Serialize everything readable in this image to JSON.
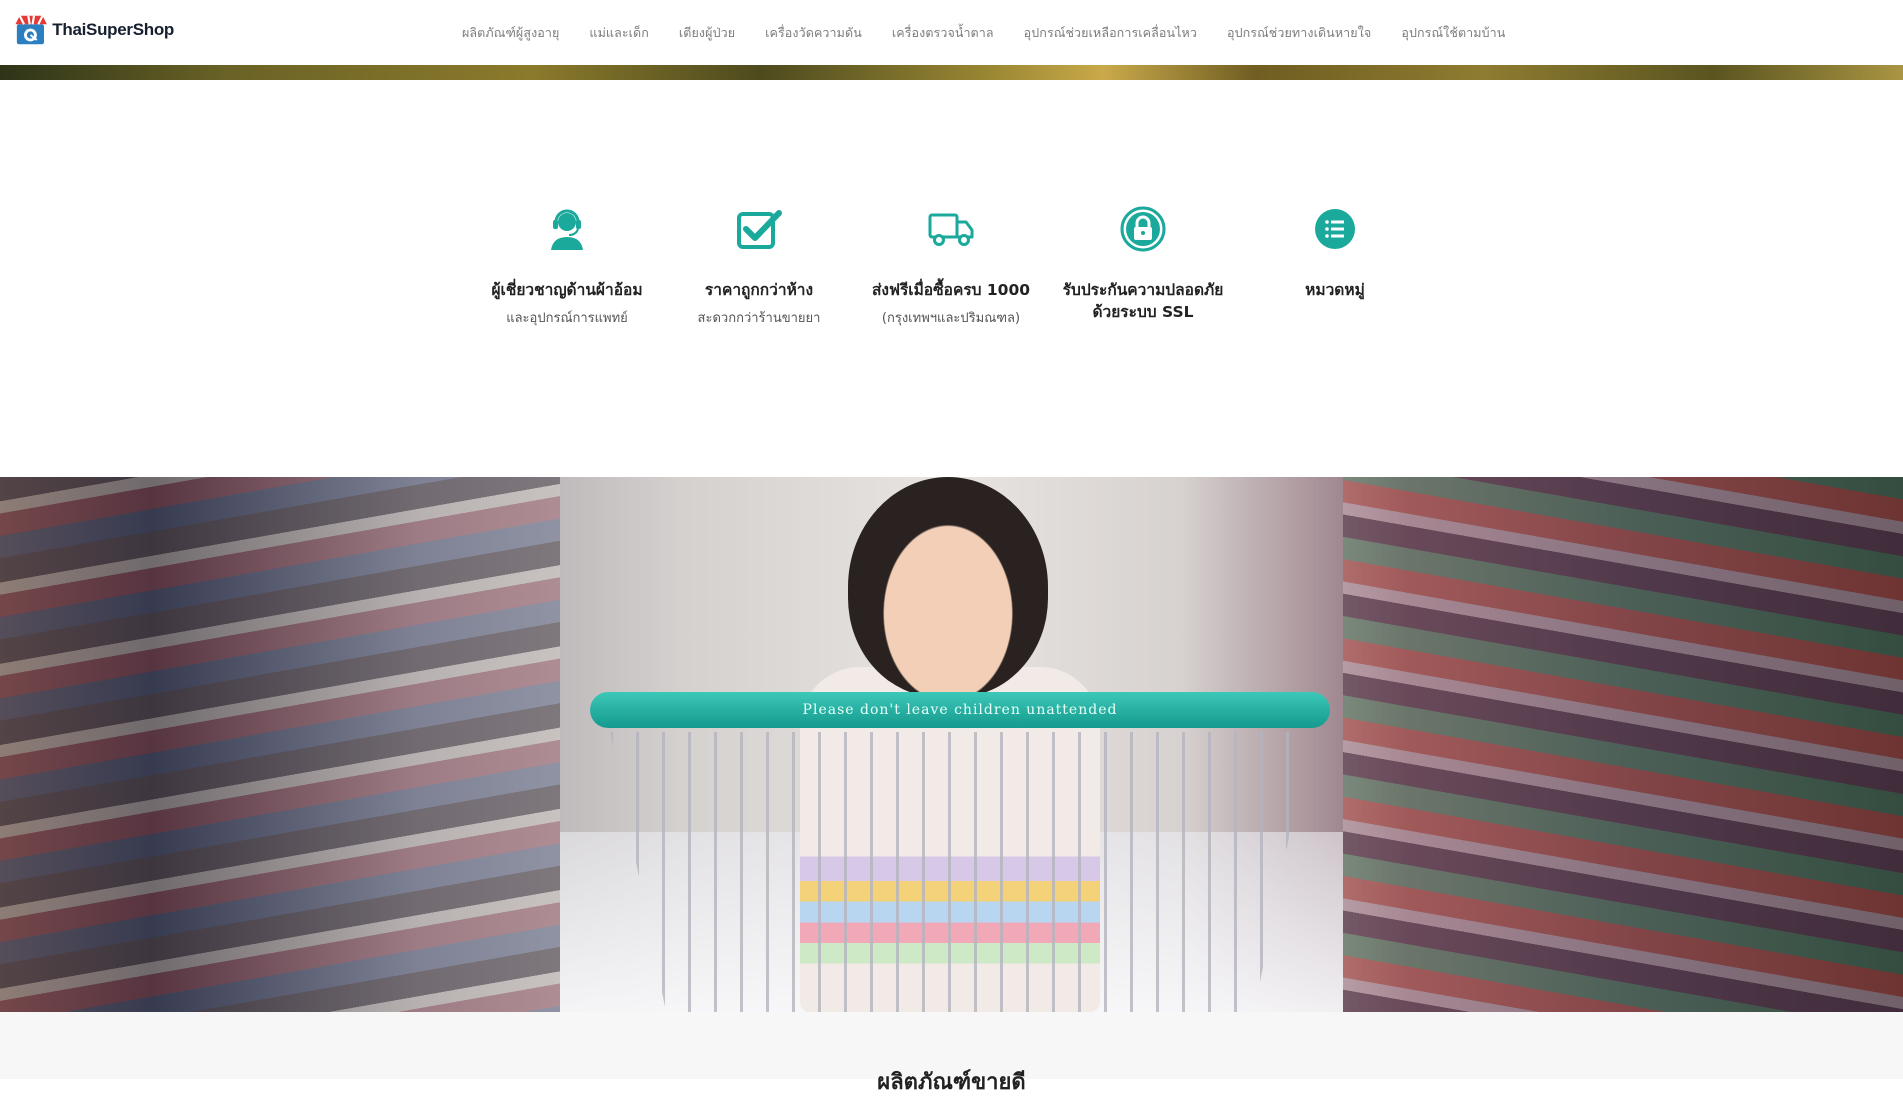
{
  "header": {
    "logo_text": "ThaiSuperShop",
    "nav": [
      {
        "label": "ผลิตภัณฑ์ผู้สูงอายุ"
      },
      {
        "label": "แม่และเด็ก"
      },
      {
        "label": "เตียงผู้ป่วย"
      },
      {
        "label": "เครื่องวัดความดัน"
      },
      {
        "label": "เครื่องตรวจน้ำตาล"
      },
      {
        "label": "อุปกรณ์ช่วยเหลือการเคลื่อนไหว"
      },
      {
        "label": "อุปกรณ์ช่วยทางเดินหายใจ"
      },
      {
        "label": "อุปกรณ์ใช้ตามบ้าน"
      }
    ]
  },
  "features": [
    {
      "icon": "support-agent-icon",
      "title": "ผู้เชี่ยวชาญด้านผ้าอ้อม",
      "sub": "และอุปกรณ์การแพทย์"
    },
    {
      "icon": "checkbox-icon",
      "title": "ราคาถูกกว่าห้าง",
      "sub": "สะดวกกว่าร้านขายยา"
    },
    {
      "icon": "truck-icon",
      "title": "ส่งฟรีเมื่อซื้อครบ 1000",
      "sub": "(กรุงเทพฯและปริมณฑล)"
    },
    {
      "icon": "lock-icon",
      "title": "รับประกันความปลอดภัยด้วยระบบ SSL",
      "sub": ""
    },
    {
      "icon": "list-icon",
      "title": "หมวดหมู่",
      "sub": ""
    }
  ],
  "banner": {
    "cart_text": "Please don't leave children unattended"
  },
  "section": {
    "heading": "ผลิตภัณฑ์ขายดี"
  },
  "colors": {
    "accent": "#1aa99b",
    "nav_text": "#7c7c7c",
    "section_bg": "#f7f7f7"
  }
}
